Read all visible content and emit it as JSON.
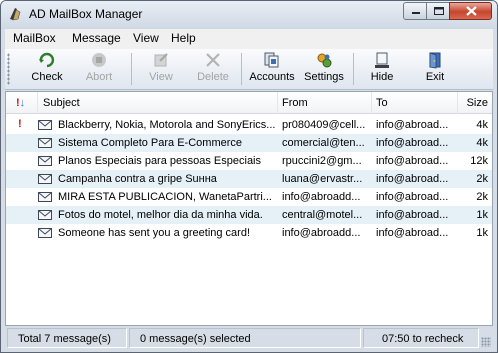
{
  "window": {
    "title": "AD MailBox Manager"
  },
  "menu": [
    {
      "label": "MailBox"
    },
    {
      "label": "Message"
    },
    {
      "label": "View"
    },
    {
      "label": "Help"
    }
  ],
  "toolbar": {
    "check": "Check",
    "abort": "Abort",
    "view": "View",
    "delete": "Delete",
    "accounts": "Accounts",
    "settings": "Settings",
    "hide": "Hide",
    "exit": "Exit"
  },
  "columns": {
    "priority": "!",
    "subject": "Subject",
    "from": "From",
    "to": "To",
    "size": "Size"
  },
  "messages": [
    {
      "priority": "!",
      "subject": "Blackberry, Nokia, Motorola and SonyErics...",
      "from": "pr080409@cell...",
      "to": "info@abroad...",
      "size": "4k"
    },
    {
      "priority": "",
      "subject": "Sistema Completo Para E-Commerce",
      "from": "comercial@ten...",
      "to": "info@abroad...",
      "size": "4k"
    },
    {
      "priority": "",
      "subject": "Planos Especiais para pessoas Especiais",
      "from": "rpuccini2@gm...",
      "to": "info@abroad...",
      "size": "12k"
    },
    {
      "priority": "",
      "subject": "Campanha contra a gripe Suнна",
      "from": "luana@ervastr...",
      "to": "info@abroad...",
      "size": "2k"
    },
    {
      "priority": "",
      "subject": "MIRA ESTA PUBLICACION, WanetaPartri...",
      "from": "info@abroadd...",
      "to": "info@abroad...",
      "size": "2k"
    },
    {
      "priority": "",
      "subject": "Fotos do motel, melhor dia da minha vida.",
      "from": "central@motel...",
      "to": "info@abroad...",
      "size": "1k"
    },
    {
      "priority": "",
      "subject": "Someone has sent you a greeting card!",
      "from": "info@abroadd...",
      "to": "info@abroad...",
      "size": "1k"
    }
  ],
  "status": {
    "total": "Total 7 message(s)",
    "selected": "0 message(s) selected",
    "recheck": "07:50 to recheck"
  },
  "colors": {
    "alt_row": "#e5f0f7",
    "priority": "#d01010",
    "close_button": "#c5462e"
  }
}
